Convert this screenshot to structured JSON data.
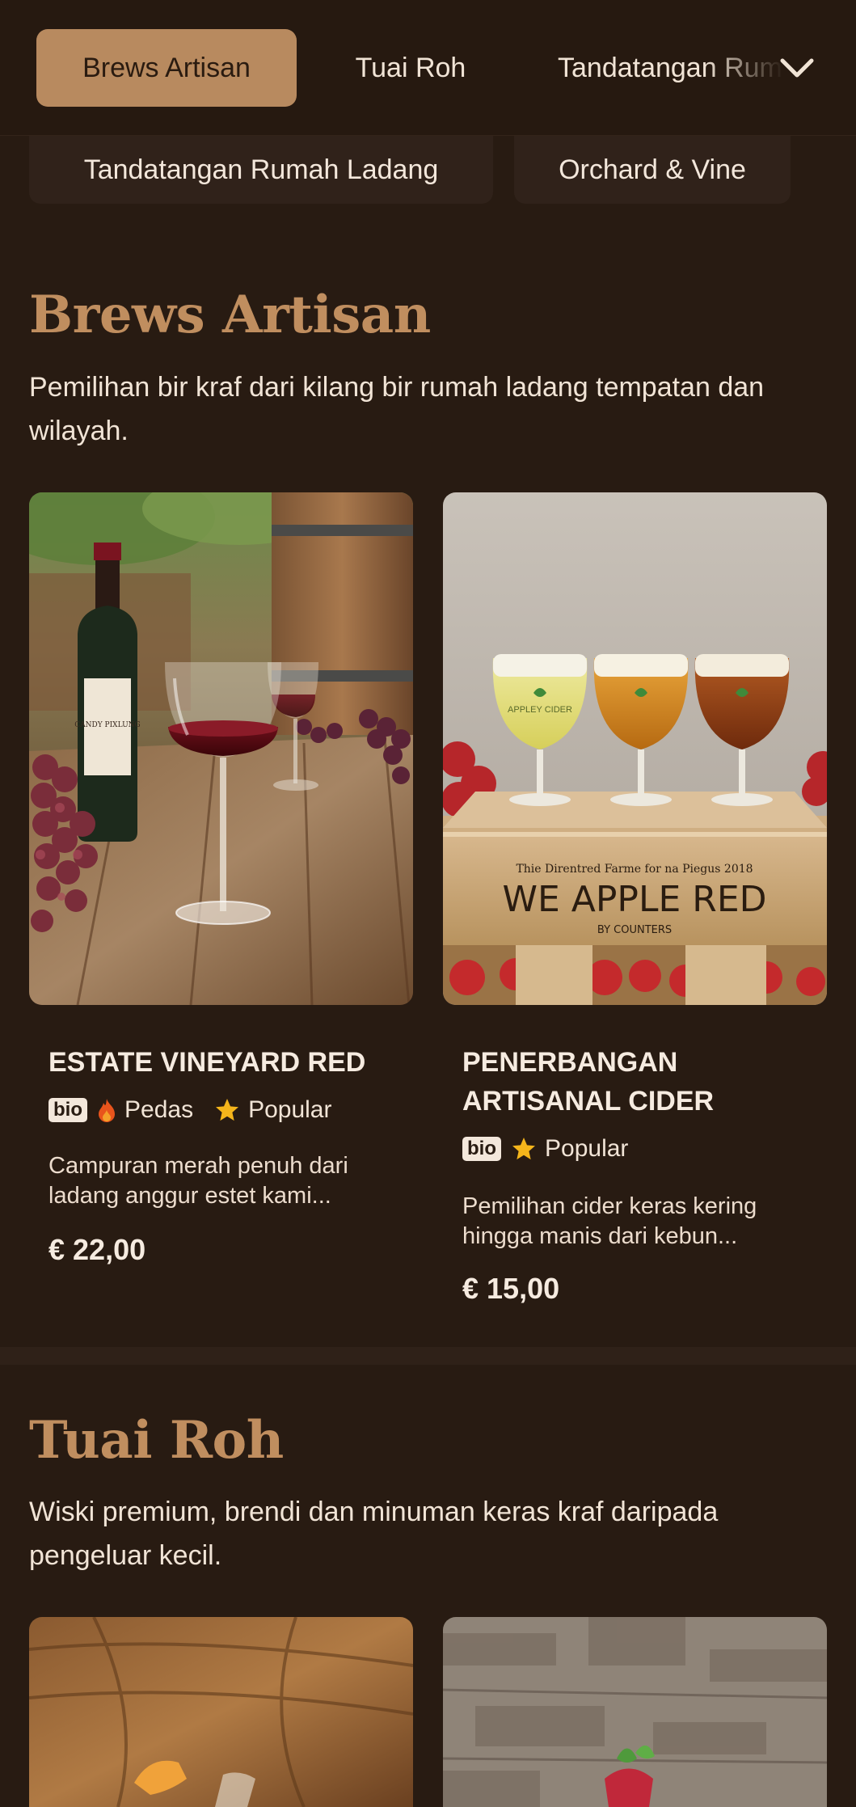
{
  "nav": {
    "tabs": [
      {
        "label": "Brews Artisan",
        "active": true
      },
      {
        "label": "Tuai Roh",
        "active": false
      },
      {
        "label": "Tandatangan Rumah Ladang",
        "active": false
      }
    ],
    "expand_icon": "chevron-down-icon",
    "chips": [
      {
        "label": "Tandatangan Rumah Ladang"
      },
      {
        "label": "Orchard & Vine"
      }
    ]
  },
  "sections": [
    {
      "title": "Brews Artisan",
      "description": "Pemilihan bir kraf dari kilang bir rumah ladang tempatan dan wilayah.",
      "products": [
        {
          "name": "ESTATE VINEYARD RED",
          "badges": {
            "bio": "bio",
            "spicy": "Pedas",
            "popular": "Popular"
          },
          "description": "Campuran merah penuh dari ladang anggur estet kami...",
          "price": "€ 22,00",
          "image_alt": "red wine glass and bottle with grapes on wooden table",
          "bottle_label": "CANDY PIXLUNG"
        },
        {
          "name": "PENERBANGAN ARTISANAL CIDER",
          "badges": {
            "bio": "bio",
            "popular": "Popular"
          },
          "description": "Pemilihan cider keras kering hingga manis dari kebun...",
          "price": "€ 15,00",
          "image_alt": "cider flight of three glasses in wooden crate with apples",
          "crate_small": "Thie Direntred Farme for na Piegus 2018",
          "crate_big": "WE APPLE RED",
          "crate_sub": "BY COUNTERS",
          "glass_label": "APPLEY CIDER"
        }
      ]
    },
    {
      "title": "Tuai Roh",
      "description": "Wiski premium, brendi dan minuman keras kraf daripada pengeluar kecil."
    }
  ],
  "colors": {
    "background": "#281b12",
    "accent": "#c08e5f",
    "active_tab": "#b88a5f",
    "chip": "#30221a",
    "star": "#f5b51b",
    "flame": "#e8541c"
  }
}
